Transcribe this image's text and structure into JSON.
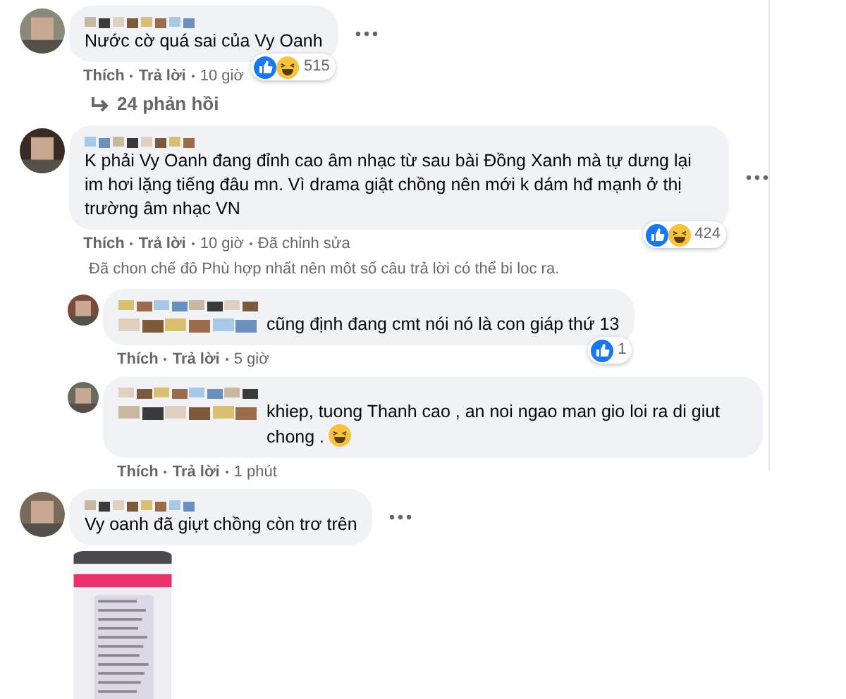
{
  "comments": [
    {
      "name_inline": false,
      "text": "Nước cờ quá sai của Vy Oanh",
      "menu": true,
      "meta": [
        "Thích",
        "Trả lời",
        "10 giờ"
      ],
      "reactions": {
        "like": true,
        "haha": true,
        "count": "515"
      },
      "replies_link": "24 phản hồi"
    },
    {
      "name_inline": false,
      "text": "K phải Vy Oanh đang đỉnh cao âm nhạc từ sau bài Đồng Xanh mà tự dưng lại im hơi lặng tiếng đâu mn. Vì drama giật chồng nên mới k dám hđ mạnh ở thị trường âm nhạc VN",
      "menu": true,
      "meta": [
        "Thích",
        "Trả lời",
        "10 giờ",
        "Đã chỉnh sửa"
      ],
      "reactions": {
        "like": true,
        "haha": true,
        "count": "424"
      },
      "filter_note": "Đã chon chế đô Phù hợp nhất nên môt số câu trả lời có thể bi loc ra.",
      "replies": [
        {
          "name_inline": true,
          "text": "cũng định đang cmt nói nó là con giáp thứ 13",
          "menu": false,
          "meta": [
            "Thích",
            "Trả lời",
            "5 giờ"
          ],
          "reactions": {
            "like": true,
            "haha": false,
            "count": "1"
          }
        },
        {
          "name_inline": true,
          "text": "khiep, tuong Thanh cao , an noi ngao man gio loi ra di giut chong .",
          "laughing_emoji": true,
          "menu": false,
          "meta": [
            "Thích",
            "Trả lời",
            "1 phút"
          ]
        }
      ]
    },
    {
      "name_inline": false,
      "text": "Vy oanh đã giựt chồng còn trơ trên",
      "menu": true
    }
  ]
}
